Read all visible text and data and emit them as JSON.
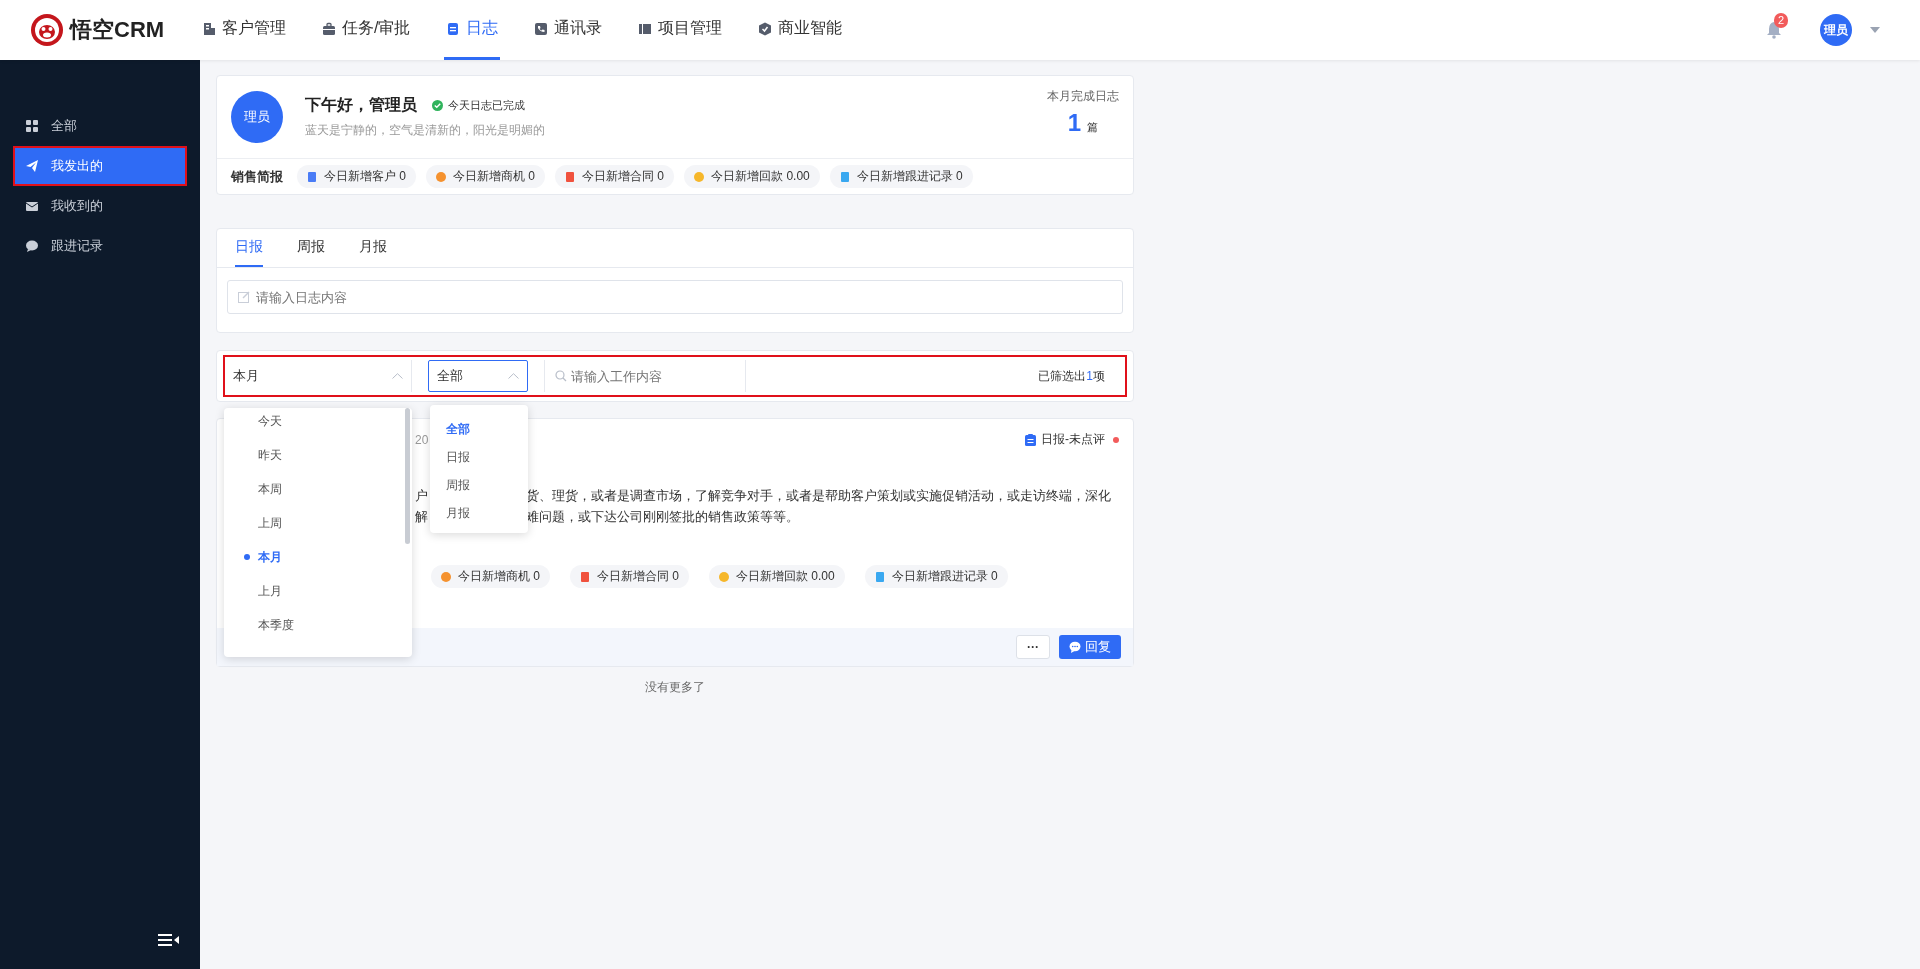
{
  "app": {
    "logo_text": "悟空CRM"
  },
  "nav": [
    {
      "label": "客户管理",
      "selected": false
    },
    {
      "label": "任务/审批",
      "selected": false
    },
    {
      "label": "日志",
      "selected": true
    },
    {
      "label": "通讯录",
      "selected": false
    },
    {
      "label": "项目管理",
      "selected": false
    },
    {
      "label": "商业智能",
      "selected": false
    }
  ],
  "notifications": {
    "badge": "2"
  },
  "user": {
    "avatar": "理员"
  },
  "sidebar": {
    "items": [
      {
        "label": "全部",
        "selected": false,
        "highlighted": false
      },
      {
        "label": "我发出的",
        "selected": true,
        "highlighted": true
      },
      {
        "label": "我收到的",
        "selected": false,
        "highlighted": false
      },
      {
        "label": "跟进记录",
        "selected": false,
        "highlighted": false
      }
    ]
  },
  "summary": {
    "avatar": "理员",
    "greeting": "下午好，管理员",
    "status": "今天日志已完成",
    "motto": "蓝天是宁静的，空气是清新的，阳光是明媚的",
    "month_label": "本月完成日志",
    "month_count": "1",
    "month_unit": "篇",
    "brief_label": "销售简报",
    "stats": [
      {
        "kind": "customer",
        "label": "今日新增客户 0"
      },
      {
        "kind": "opportunity",
        "label": "今日新增商机 0"
      },
      {
        "kind": "contract",
        "label": "今日新增合同 0"
      },
      {
        "kind": "payment",
        "label": "今日新增回款 0.00"
      },
      {
        "kind": "followup",
        "label": "今日新增跟进记录 0"
      }
    ]
  },
  "log_tabs": [
    {
      "label": "日报",
      "selected": true
    },
    {
      "label": "周报",
      "selected": false
    },
    {
      "label": "月报",
      "selected": false
    }
  ],
  "log_input": {
    "placeholder": "请输入日志内容"
  },
  "filter": {
    "highlighted": true,
    "period": "本月",
    "type": "全部",
    "search_placeholder": "请输入工作内容",
    "result_prefix": "已筛选出",
    "result_count": "1",
    "result_suffix": "项"
  },
  "period_menu": [
    {
      "label": "今天",
      "selected": false
    },
    {
      "label": "昨天",
      "selected": false
    },
    {
      "label": "本周",
      "selected": false
    },
    {
      "label": "上周",
      "selected": false
    },
    {
      "label": "本月",
      "selected": true
    },
    {
      "label": "上月",
      "selected": false
    },
    {
      "label": "本季度",
      "selected": false
    }
  ],
  "type_menu": [
    {
      "label": "全部",
      "selected": true
    },
    {
      "label": "日报",
      "selected": false
    },
    {
      "label": "周报",
      "selected": false
    },
    {
      "label": "月报",
      "selected": false
    }
  ],
  "log_card": {
    "date_fragment": "20",
    "tag": "日报-未点评",
    "unread": true,
    "lines": [
      {
        "lead": "户",
        "rest": "货、理货，或者是调查市场，了解竞争对手，或者是帮助客户策划或实施促销活动，或走访终端，深化"
      },
      {
        "lead": "解",
        "rest": "难问题，或下达公司刚刚签批的销售政策等等。"
      }
    ],
    "stats": [
      {
        "kind": "opportunity",
        "label": "今日新增商机 0"
      },
      {
        "kind": "contract",
        "label": "今日新增合同 0"
      },
      {
        "kind": "payment",
        "label": "今日新增回款 0.00"
      },
      {
        "kind": "followup",
        "label": "今日新增跟进记录 0"
      }
    ],
    "more": "···",
    "reply": "回复"
  },
  "end_text": "没有更多了"
}
